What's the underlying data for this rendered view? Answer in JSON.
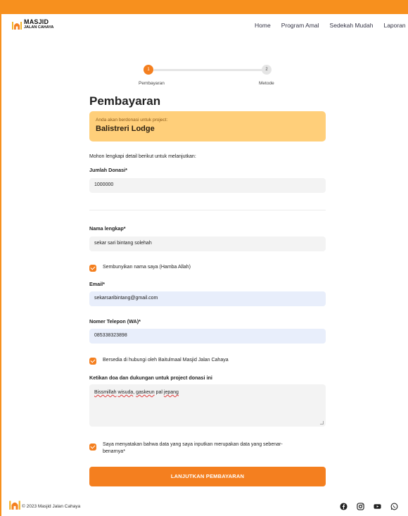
{
  "brand": {
    "name": "MASJID",
    "sub": "JALAN CAHAYA"
  },
  "nav": [
    "Home",
    "Program Amal",
    "Sedekah Mudah",
    "Laporan"
  ],
  "stepper": {
    "step1_num": "1",
    "step1_label": "Pembayaran",
    "step2_num": "2",
    "step2_label": "Metode"
  },
  "page_title": "Pembayaran",
  "project": {
    "intro": "Anda akan berdonasi untuk project:",
    "name": "Balistreri Lodge"
  },
  "form": {
    "instructions": "Mohon lengkapi detail berikut untuk melanjutkan:",
    "amount_label": "Jumlah Donasi*",
    "amount_value": "1000000",
    "name_label": "Nama lengkap*",
    "name_value": "sekar sari bintang solehah",
    "hide_name_label": "Sembunyikan nama saya (Hamba Allah)",
    "email_label": "Email*",
    "email_value": "sekarsaribintang@gmail.com",
    "phone_label": "Nomer Telepon (WA)*",
    "phone_value": "085338323898",
    "contact_consent_label": "Bersedia di hubungi oleh Baitulmaal Masjid Jalan Cahaya",
    "prayer_label": "Ketikan doa dan dukungan untuk project donasi ini",
    "prayer_words": [
      "Bissmillah",
      "wisuda",
      "gaskeun",
      "pal",
      "jepang"
    ],
    "declaration_line1": "Saya menyatakan bahwa data yang saya inputkan merupakan data yang sebenar-",
    "declaration_line2": "benarnya*",
    "submit_label": "LANJUTKAN PEMBAYARAN"
  },
  "footer": {
    "copyright": "© 2023 Masjid Jalan Cahaya",
    "social_icons": [
      "facebook-icon",
      "instagram-icon",
      "youtube-icon",
      "whatsapp-icon"
    ]
  },
  "colors": {
    "accent": "#f47f1f",
    "border": "#f7901e",
    "project_box": "#ffcf7a"
  }
}
